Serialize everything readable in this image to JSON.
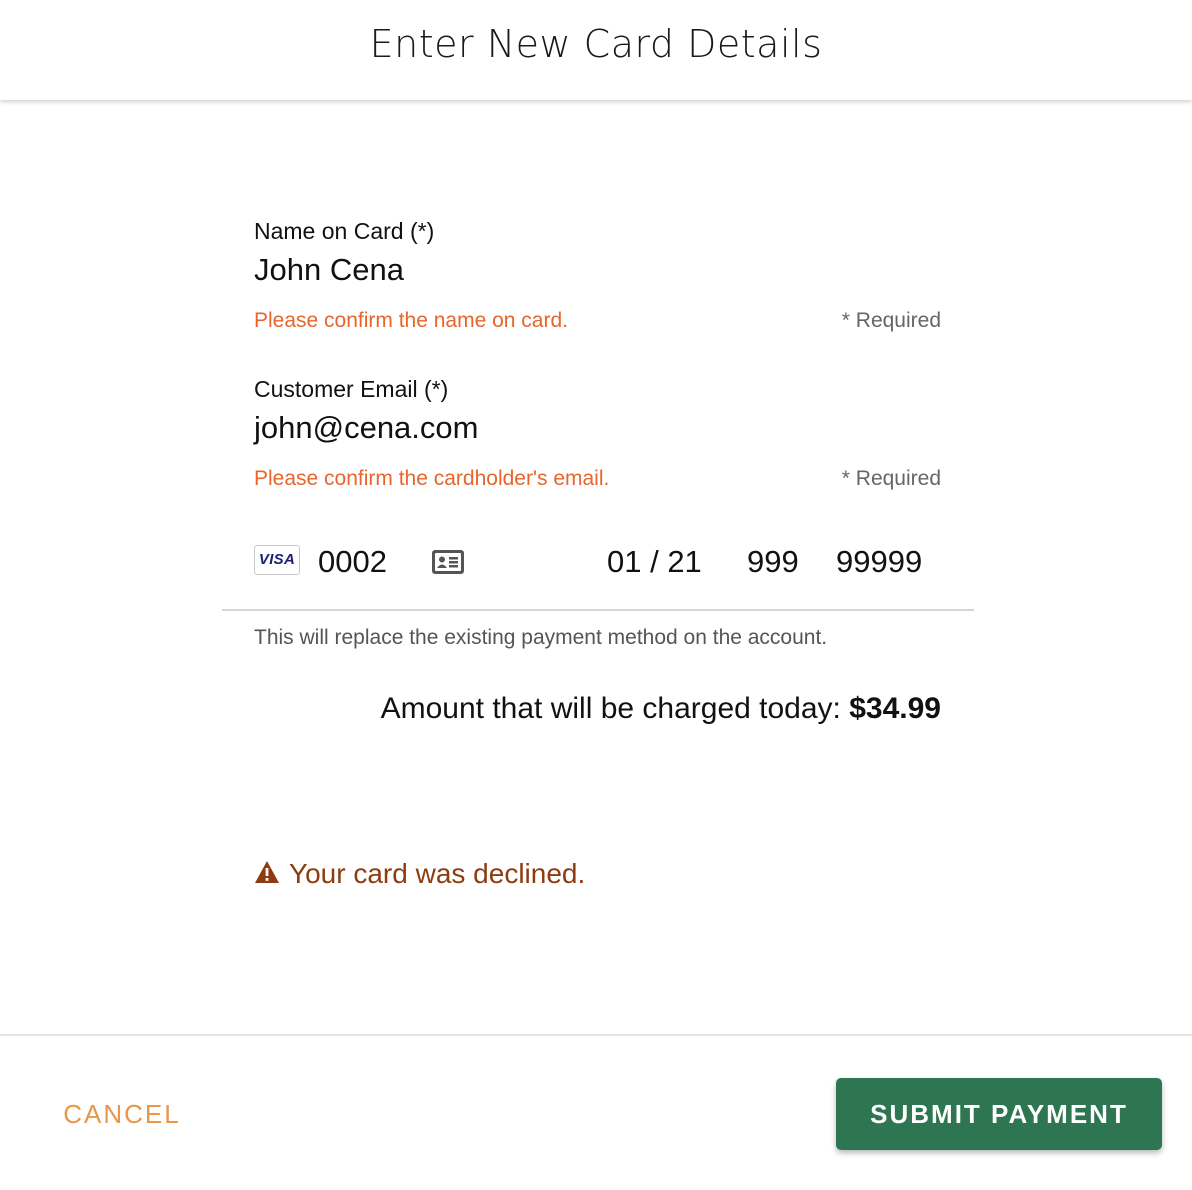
{
  "dialog": {
    "title": "Enter New Card Details"
  },
  "form": {
    "name_field": {
      "label": "Name on Card (*)",
      "value": "John Cena",
      "error": "Please confirm the name on card.",
      "required": "* Required"
    },
    "email_field": {
      "label": "Customer Email (*)",
      "value": "john@cena.com",
      "error": "Please confirm the cardholder's email.",
      "required": "* Required"
    },
    "card": {
      "brand": "VISA",
      "brand_icon": "visa-card-icon",
      "last4": "0002",
      "contact_icon": "id-card-icon",
      "expiry": "01 / 21",
      "cvc": "999",
      "zip": "99999"
    },
    "replace_note": "This will replace the existing payment method on the account.",
    "amount_label": "Amount that will be charged today:",
    "amount_value": "$34.99",
    "decline": {
      "icon": "warning-icon",
      "message": "Your card was declined."
    }
  },
  "footer": {
    "cancel_label": "CANCEL",
    "submit_label": "SUBMIT PAYMENT"
  },
  "colors": {
    "error": "#e8652b",
    "decline": "#8e3b10",
    "cancel": "#e8964a",
    "submit_bg": "#2e7651"
  }
}
